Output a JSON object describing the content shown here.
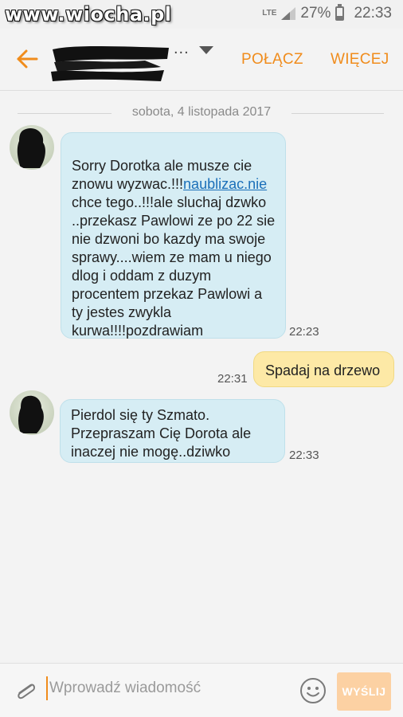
{
  "status_bar": {
    "watermark": "www.wiocha.pl",
    "network": "LTE",
    "battery": "27%",
    "time": "22:33"
  },
  "header": {
    "contact_name_visible": "...",
    "call_label": "POŁĄCZ",
    "more_label": "WIĘCEJ",
    "accent_color": "#f08c1c"
  },
  "conversation": {
    "date_separator": "sobota, 4 listopada 2017",
    "messages": [
      {
        "direction": "incoming",
        "text_before_link": "Sorry Dorotka ale musze cie znowu wyzwac.!!!",
        "link": "naublizac.nie",
        "text_after_link": " chce tego..!!!ale sluchaj dzwko ..przekasz Pawlowi ze po 22 sie nie dzwoni bo kazdy ma swoje sprawy....wiem ze mam u niego dlog i oddam z duzym procentem przekaz Pawlowi a ty jestes zwykla kurwa!!!!pozdrawiam",
        "time": "22:23"
      },
      {
        "direction": "outgoing",
        "text": "Spadaj na drzewo",
        "time": "22:31"
      },
      {
        "direction": "incoming",
        "text": "Pierdol się ty Szmato. Przepraszam Cię Dorota ale inaczej nie mogę..dziwko",
        "time": "22:33"
      }
    ]
  },
  "composer": {
    "placeholder": "Wprowadź wiadomość",
    "send_label": "WYŚLIJ",
    "icons": [
      "attach-icon",
      "emoji-icon"
    ]
  }
}
